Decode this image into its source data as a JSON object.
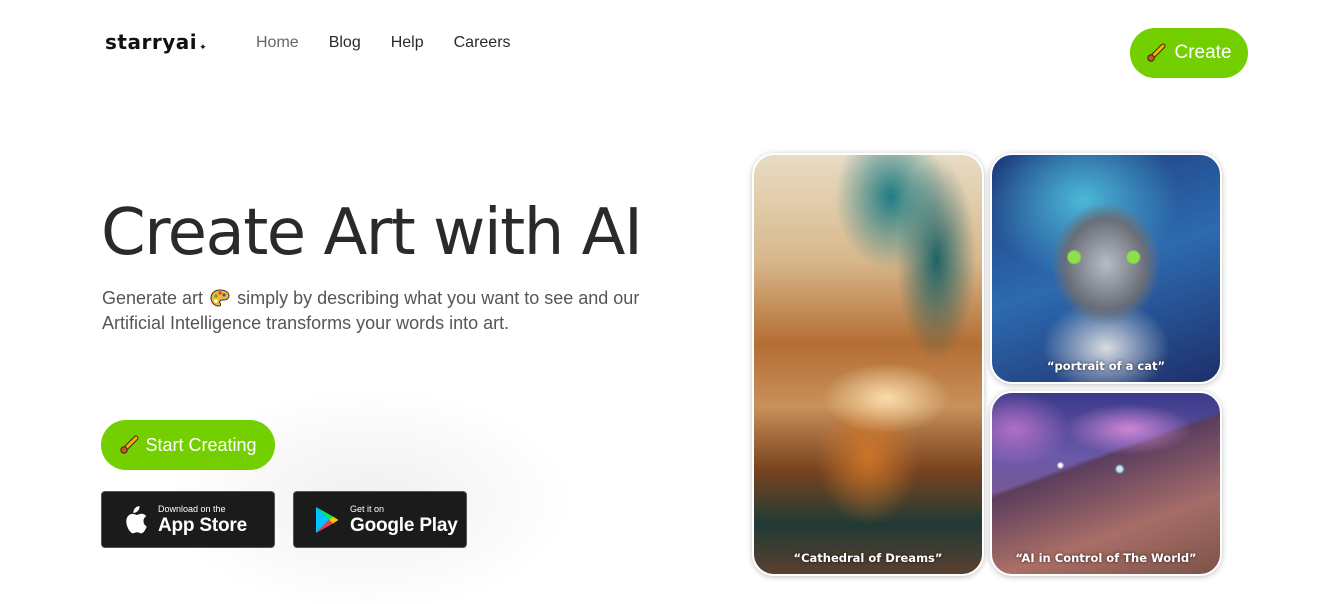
{
  "nav": {
    "logo": "starryai",
    "logo_mark": "✦",
    "links": [
      {
        "label": "Home",
        "active": true
      },
      {
        "label": "Blog",
        "active": false
      },
      {
        "label": "Help",
        "active": false
      },
      {
        "label": "Careers",
        "active": false
      }
    ],
    "create_button": {
      "label": "Create",
      "icon": "paintbrush-icon"
    }
  },
  "hero": {
    "title": "Create Art with AI",
    "subtitle_part1": "Generate art",
    "subtitle_icon": "artist-palette-icon",
    "subtitle_part2": "simply by describing what you want to see and our Artificial Intelligence transforms your words into art.",
    "start_button": {
      "label": "Start Creating",
      "icon": "paintbrush-icon"
    },
    "app_store": {
      "small": "Download on the",
      "big": "App Store",
      "icon": "apple-icon"
    },
    "google_play": {
      "small": "Get it on",
      "big": "Google Play",
      "icon": "google-play-icon"
    }
  },
  "gallery": [
    {
      "caption": "“Cathedral of Dreams”"
    },
    {
      "caption": "“portrait of a cat”"
    },
    {
      "caption": "“AI in Control of The World”"
    }
  ],
  "colors": {
    "accent": "#73cf00",
    "store_bg": "#1b1b1b",
    "text": "#2a2a2a"
  }
}
